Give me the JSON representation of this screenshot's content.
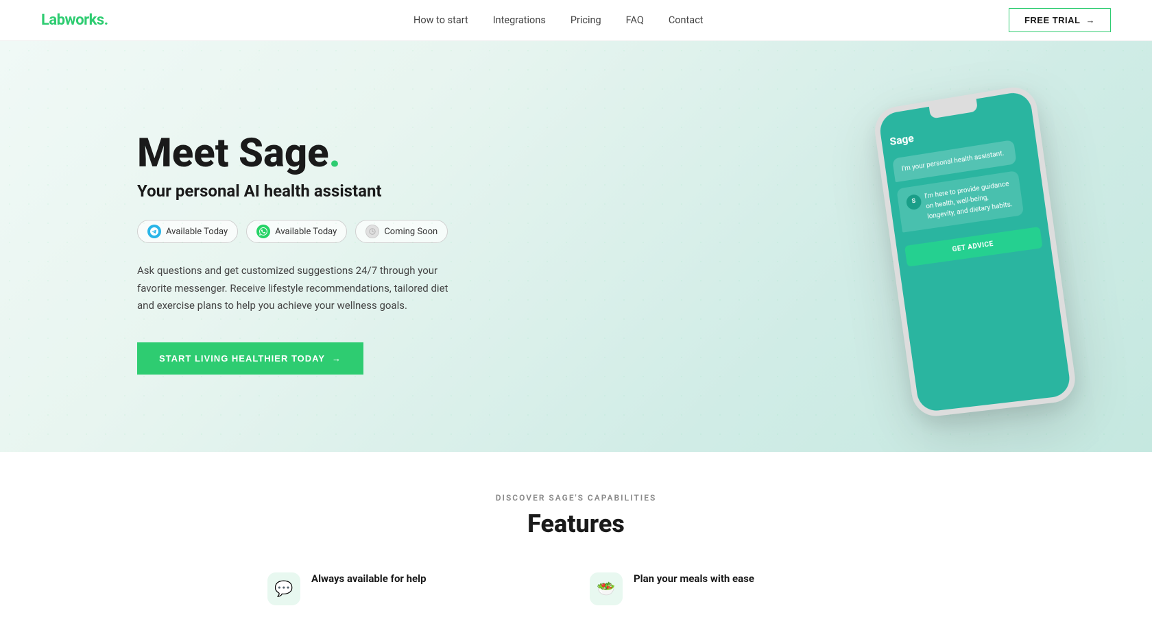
{
  "nav": {
    "logo_text": "Labworks",
    "logo_dot": ".",
    "links": [
      {
        "label": "How to start",
        "href": "#"
      },
      {
        "label": "Integrations",
        "href": "#"
      },
      {
        "label": "Pricing",
        "href": "#"
      },
      {
        "label": "FAQ",
        "href": "#"
      },
      {
        "label": "Contact",
        "href": "#"
      }
    ],
    "free_trial_label": "FREE TRIAL"
  },
  "hero": {
    "title_prefix": "Meet Sage",
    "title_dot": ".",
    "subtitle": "Your personal AI health assistant",
    "badges": [
      {
        "id": "telegram",
        "label": "Available Today",
        "type": "telegram"
      },
      {
        "id": "whatsapp",
        "label": "Available Today",
        "type": "whatsapp"
      },
      {
        "id": "coming",
        "label": "Coming Soon",
        "type": "coming"
      }
    ],
    "description": "Ask questions and get customized suggestions 24/7 through your favorite messenger. Receive lifestyle recommendations, tailored diet and exercise plans to help you achieve your wellness goals.",
    "cta_label": "START LIVING HEALTHIER TODAY"
  },
  "phone": {
    "app_name": "Sage",
    "bubble1": "I'm your personal health assistant.",
    "bubble2": "I'm here to provide guidance on health, well-being, longevity, and dietary habits.",
    "sage_initial": "S",
    "get_advice_label": "GET ADVICE"
  },
  "features": {
    "section_label": "DISCOVER SAGE'S CAPABILITIES",
    "section_title": "Features",
    "items": [
      {
        "label": "Always available for help"
      },
      {
        "label": "Plan your meals with ease"
      }
    ]
  }
}
